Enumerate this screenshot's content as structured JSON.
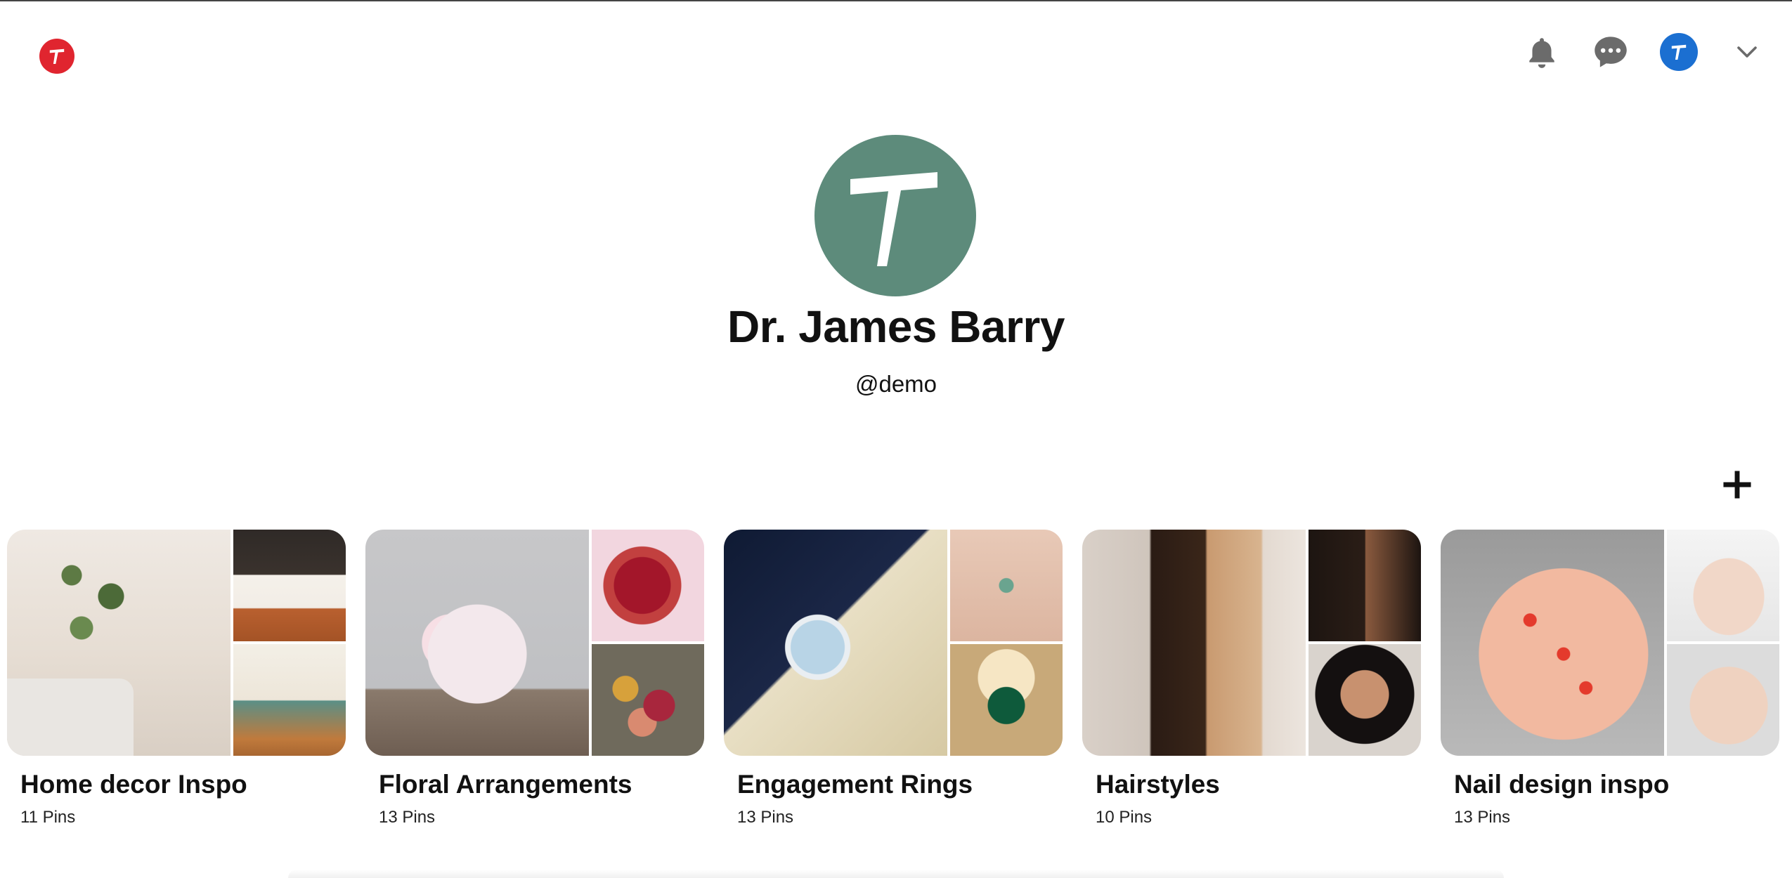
{
  "app": {
    "logo_icon": "t-logo-icon",
    "accent_color": "#e0252f"
  },
  "header": {
    "notifications_icon": "bell-icon",
    "messages_icon": "chat-bubble-icon",
    "account_icon": "t-avatar-icon",
    "account_color": "#1b6fd1",
    "menu_icon": "chevron-down-icon"
  },
  "profile": {
    "name": "Dr. James Barry",
    "handle": "@demo",
    "avatar_color": "#5d8b7b"
  },
  "actions": {
    "add_icon": "plus-icon"
  },
  "boards": [
    {
      "title": "Home decor Inspo",
      "count": "11 Pins"
    },
    {
      "title": "Floral Arrangements",
      "count": "13 Pins"
    },
    {
      "title": "Engagement Rings",
      "count": "13 Pins"
    },
    {
      "title": "Hairstyles",
      "count": "10 Pins"
    },
    {
      "title": "Nail design inspo",
      "count": "13 Pins"
    }
  ]
}
